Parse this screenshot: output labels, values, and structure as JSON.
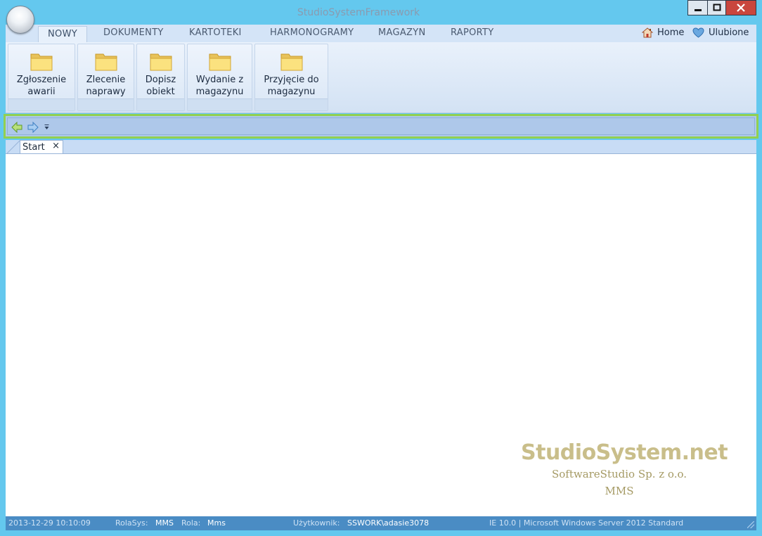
{
  "window": {
    "title": "StudioSystemFramework"
  },
  "ribbon": {
    "tabs": [
      {
        "label": "NOWY"
      },
      {
        "label": "DOKUMENTY"
      },
      {
        "label": "KARTOTEKI"
      },
      {
        "label": "HARMONOGRAMY"
      },
      {
        "label": "MAGAZYN"
      },
      {
        "label": "RAPORTY"
      }
    ],
    "home_label": "Home",
    "favorites_label": "Ulubione",
    "buttons": [
      {
        "line1": "Zgłoszenie",
        "line2": "awarii",
        "icon": "folder-icon"
      },
      {
        "line1": "Zlecenie",
        "line2": "naprawy",
        "icon": "folder-icon"
      },
      {
        "line1": "Dopisz",
        "line2": "obiekt",
        "icon": "folder-icon"
      },
      {
        "line1": "Wydanie z",
        "line2": "magazynu",
        "icon": "folder-icon"
      },
      {
        "line1": "Przyjęcie do",
        "line2": "magazynu",
        "icon": "folder-icon"
      }
    ]
  },
  "nav": {
    "back_icon": "arrow-left-icon",
    "forward_icon": "arrow-right-icon",
    "dropdown_icon": "chevron-down-icon",
    "highlight_color": "#92d050"
  },
  "doc_tabs": [
    {
      "label": "Start",
      "close": "×"
    }
  ],
  "branding": {
    "name": "StudioSystem.net",
    "company": "SoftwareStudio Sp. z o.o.",
    "module": "MMS"
  },
  "status": {
    "datetime": "2013-12-29 10:10:09",
    "rolasys_label": "RolaSys:",
    "rolasys_value": "MMS",
    "rola_label": "Rola:",
    "rola_value": "Mms",
    "user_label": "Użytkownik:",
    "user_value": "SSWORK\\adasie3078",
    "env": "IE 10.0 | Microsoft Windows Server 2012 Standard"
  },
  "colors": {
    "frame": "#64c8ee",
    "close_button": "#c9463d",
    "status_bar": "#4a8cc4",
    "brand_text": "#c9be8a"
  }
}
